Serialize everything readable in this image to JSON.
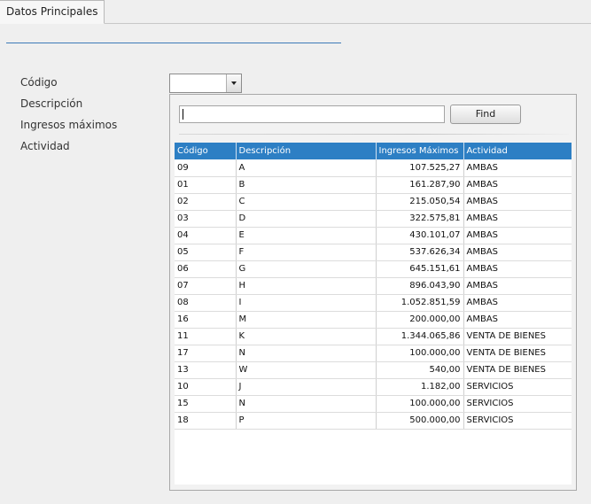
{
  "tabs": [
    {
      "label": "Datos Principales"
    }
  ],
  "form": {
    "labels": [
      "Código",
      "Descripción",
      "Ingresos máximos",
      "Actividad"
    ],
    "codigo_value": ""
  },
  "popup": {
    "search_value": "",
    "find_label": "Find",
    "columns": [
      "Código",
      "Descripción",
      "Ingresos Máximos",
      "Actividad"
    ],
    "rows": [
      {
        "codigo": "09",
        "descripcion": "A",
        "ingresos": "107.525,27",
        "actividad": "AMBAS"
      },
      {
        "codigo": "01",
        "descripcion": "B",
        "ingresos": "161.287,90",
        "actividad": "AMBAS"
      },
      {
        "codigo": "02",
        "descripcion": "C",
        "ingresos": "215.050,54",
        "actividad": "AMBAS"
      },
      {
        "codigo": "03",
        "descripcion": "D",
        "ingresos": "322.575,81",
        "actividad": "AMBAS"
      },
      {
        "codigo": "04",
        "descripcion": "E",
        "ingresos": "430.101,07",
        "actividad": "AMBAS"
      },
      {
        "codigo": "05",
        "descripcion": "F",
        "ingresos": "537.626,34",
        "actividad": "AMBAS"
      },
      {
        "codigo": "06",
        "descripcion": "G",
        "ingresos": "645.151,61",
        "actividad": "AMBAS"
      },
      {
        "codigo": "07",
        "descripcion": "H",
        "ingresos": "896.043,90",
        "actividad": "AMBAS"
      },
      {
        "codigo": "08",
        "descripcion": "I",
        "ingresos": "1.052.851,59",
        "actividad": "AMBAS"
      },
      {
        "codigo": "16",
        "descripcion": "M",
        "ingresos": "200.000,00",
        "actividad": "AMBAS"
      },
      {
        "codigo": "11",
        "descripcion": "K",
        "ingresos": "1.344.065,86",
        "actividad": "VENTA DE BIENES"
      },
      {
        "codigo": "17",
        "descripcion": "N",
        "ingresos": "100.000,00",
        "actividad": "VENTA DE BIENES"
      },
      {
        "codigo": "13",
        "descripcion": "W",
        "ingresos": "540,00",
        "actividad": "VENTA DE BIENES"
      },
      {
        "codigo": "10",
        "descripcion": "J",
        "ingresos": "1.182,00",
        "actividad": "SERVICIOS"
      },
      {
        "codigo": "15",
        "descripcion": "N",
        "ingresos": "100.000,00",
        "actividad": "SERVICIOS"
      },
      {
        "codigo": "18",
        "descripcion": "P",
        "ingresos": "500.000,00",
        "actividad": "SERVICIOS"
      }
    ]
  },
  "colors": {
    "header": "#2d7fc4",
    "divider": "#3d7ab8"
  }
}
